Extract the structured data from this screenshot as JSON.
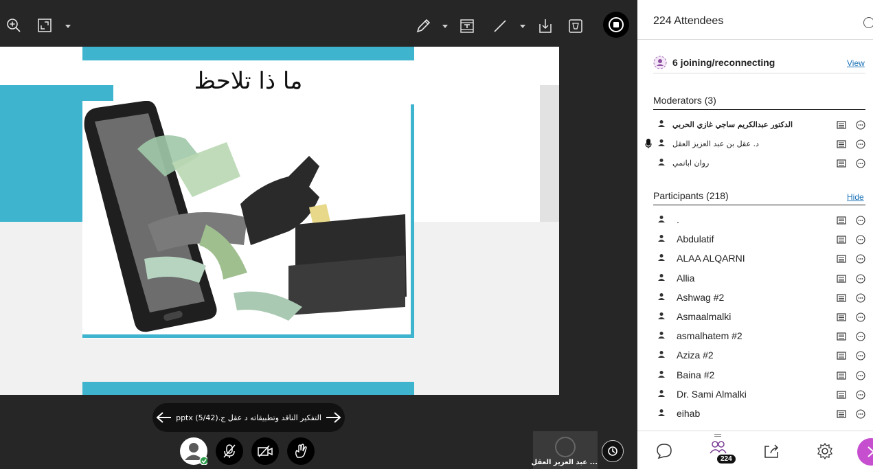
{
  "toolbar": {
    "zoom_icon": "zoom-in-icon",
    "fullscreen_icon": "expand-icon",
    "tools": [
      "pencil-icon",
      "text-icon",
      "line-icon",
      "download-icon",
      "clear-icon",
      "stop-share-icon"
    ]
  },
  "slide": {
    "title": "ما ذا تلاحظ",
    "accent_color": "#3fb4cf"
  },
  "navigation": {
    "file_title": "التفكير الناقد وتطبيقاته د عقل ج.pptx",
    "page": "(5/42)"
  },
  "controls": {
    "status_icon": "avatar-available-icon",
    "mic_icon": "mic-off-icon",
    "camera_icon": "camera-off-icon",
    "hand_icon": "raise-hand-icon",
    "timer_icon": "clock-icon"
  },
  "video": {
    "name": "... عبد العزيز العقل"
  },
  "panel": {
    "title": "224 Attendees",
    "joining": {
      "text": "6 joining/reconnecting",
      "link": "View"
    },
    "moderators": {
      "heading": "Moderators (3)",
      "items": [
        {
          "name": "الدكتور عبدالكريم ساجي غازي الحربي",
          "bold": true,
          "mic": false
        },
        {
          "name": "د. عقل بن عبد العزيز العقل",
          "bold": false,
          "mic": true
        },
        {
          "name": "روان ابانمي",
          "bold": false,
          "mic": false
        }
      ]
    },
    "participants": {
      "heading": "Participants (218)",
      "link": "Hide",
      "items": [
        {
          "name": "."
        },
        {
          "name": "Abdulatif"
        },
        {
          "name": "ALAA ALQARNI"
        },
        {
          "name": "Allia"
        },
        {
          "name": "Ashwag #2"
        },
        {
          "name": "Asmaalmalki"
        },
        {
          "name": "asmalhatem #2"
        },
        {
          "name": "Aziza #2"
        },
        {
          "name": "Baina #2"
        },
        {
          "name": "Dr. Sami Almalki"
        },
        {
          "name": "eihab"
        }
      ]
    },
    "footer": {
      "chat_icon": "chat-icon",
      "attendees_icon": "attendees-icon",
      "attendees_badge": "224",
      "share_icon": "share-icon",
      "settings_icon": "gear-icon"
    }
  }
}
